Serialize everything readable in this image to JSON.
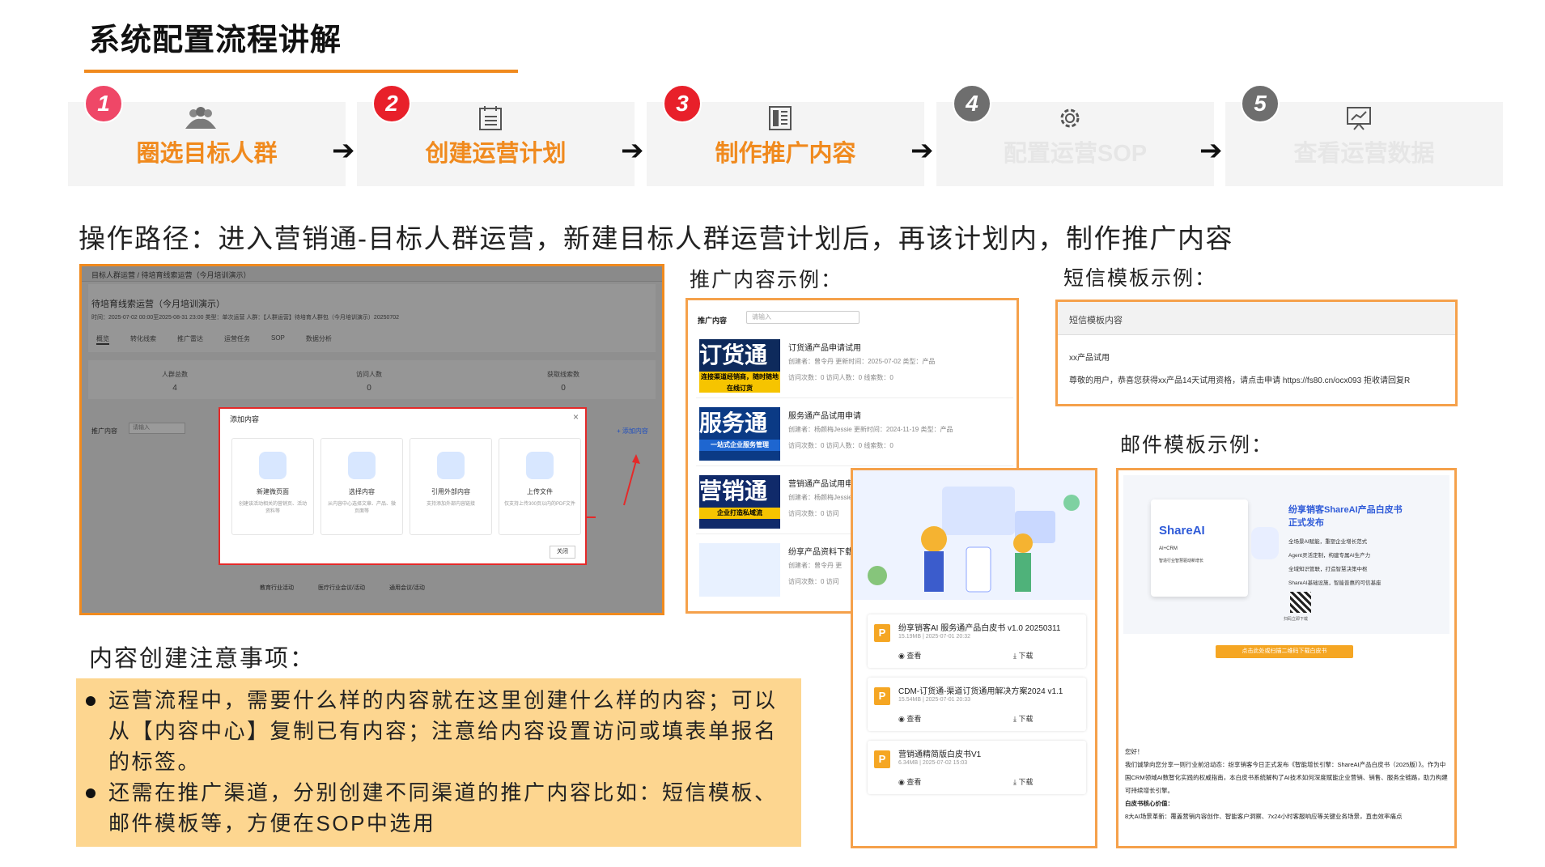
{
  "page": {
    "title": "系统配置流程讲解"
  },
  "steps": [
    {
      "num": "1",
      "label": "圈选目标人群",
      "icon": "people-icon",
      "state": "active",
      "num_color": "#EF4767"
    },
    {
      "num": "2",
      "label": "创建运营计划",
      "icon": "calendar-list-icon",
      "state": "active",
      "num_color": "#E8202A"
    },
    {
      "num": "3",
      "label": "制作推广内容",
      "icon": "content-layout-icon",
      "state": "active",
      "num_color": "#E8202A"
    },
    {
      "num": "4",
      "label": "配置运营SOP",
      "icon": "gear-icon",
      "state": "inactive",
      "num_color": "#6E6E6E"
    },
    {
      "num": "5",
      "label": "查看运营数据",
      "icon": "presentation-chart-icon",
      "state": "inactive",
      "num_color": "#6E6E6E"
    }
  ],
  "operation_path": "操作路径：进入营销通-目标人群运营，新建目标人群运营计划后，再该计划内，制作推广内容",
  "captions": {
    "promo": "推广内容示例：",
    "sms": "短信模板示例：",
    "email": "邮件模板示例："
  },
  "left_shot": {
    "breadcrumb": "目标人群运营 / 待培育线索运营（今月培训演示）",
    "plan_title": "待培育线索运营（今月培训演示）",
    "plan_meta": "时间：2025-07-02 00:00至2025-08-31 23:00    类型：单次运营    人群：【人群运营】待培育人群包（今月培训演示）20250702",
    "tabs": [
      "概览",
      "转化线索",
      "推广雷达",
      "运营任务",
      "SOP",
      "数据分析"
    ],
    "stats": [
      {
        "label": "人群总数",
        "value": "4"
      },
      {
        "label": "访问人数",
        "value": "0"
      },
      {
        "label": "获取线索数",
        "value": "0"
      }
    ],
    "section_label": "推广内容",
    "search_placeholder": "请输入",
    "add_link": "+ 添加内容",
    "modal": {
      "title": "添加内容",
      "close": "×",
      "cards": [
        {
          "title": "新建微页面",
          "desc": "创建该活动相关的营销页、活动资料等"
        },
        {
          "title": "选择内容",
          "desc": "从内容中心选择文章、产品、微页面等"
        },
        {
          "title": "引用外部内容",
          "desc": "支持添加外部内容链接"
        },
        {
          "title": "上传文件",
          "desc": "仅支持上传300页以内的PDF文件"
        }
      ],
      "close_button": "关闭"
    },
    "footer_labels": [
      "教育行业活动",
      "医疗行业会议/活动",
      "通用会议/活动"
    ]
  },
  "promo_shot": {
    "header_label": "推广内容",
    "search_placeholder": "请输入",
    "items": [
      {
        "thumb": "订货通",
        "thumb_sub": "连接渠道经销商，随时随地在线订货",
        "title": "订货通产品申请试用",
        "meta": "创建者：曾令丹    更新时间：2025-07-02    类型：产品",
        "stats": "访问次数：0    访问人数：0    线索数：0"
      },
      {
        "thumb": "服务通",
        "thumb_sub": "一站式企业服务管理",
        "title": "服务通产品试用申请",
        "meta": "创建者：杨颜梅Jessie    更新时间：2024-11-19    类型：产品",
        "stats": "访问次数：0    访问人数：0    线索数：0"
      },
      {
        "thumb": "营销通",
        "thumb_sub": "企业打造私域流",
        "title": "营销通产品试用申",
        "meta": "创建者：杨颜梅Jessie",
        "stats": "访问次数：0    访问"
      },
      {
        "thumb": "",
        "thumb_sub": "",
        "title": "纷享产品资料下载",
        "meta": "创建者：曾令丹    更",
        "stats": "访问次数：0    访问"
      }
    ]
  },
  "sms_shot": {
    "header": "短信模板内容",
    "line1": "xx产品试用",
    "line2": "尊敬的用户，恭喜您获得xx产品14天试用资格，请点击申请 https://fs80.cn/ocx093 拒收请回复R"
  },
  "doc_shot": {
    "docs": [
      {
        "title": "纷享销客AI 服务通产品白皮书 v1.0 20250311",
        "meta": "15.19MB  |  2025-07-01 20:32",
        "view": "查看",
        "download": "下载"
      },
      {
        "title": "CDM-订货通-渠道订货通用解决方案2024 v1.1",
        "meta": "15.54MB  |  2025-07-01 20:33",
        "view": "查看",
        "download": "下载"
      },
      {
        "title": "营销通精简版白皮书V1",
        "meta": "6.34MB  |  2025-07-02 15:03",
        "view": "查看",
        "download": "下载"
      }
    ]
  },
  "mail_shot": {
    "brand": "ShareAI",
    "brand_sub": "AI+CRM",
    "brand_tag": "智造行业智慧驱动新增长",
    "headline1": "纷享销客ShareAI产品白皮书",
    "headline2": "正式发布",
    "bullets": [
      "全场景AI赋能，重塑企业增长范式",
      "Agent灵活定制，构建专属AI生产力",
      "全域知识管联，打造智慧决策中枢",
      "ShareAI基础设施，智能普惠的可信基座"
    ],
    "qr_caption": "扫码立即下载",
    "cta": "点击此处或扫描二维码下载白皮书",
    "greeting": "您好！",
    "body1": "我们诚挚向您分享一则行业前沿动态：纷享销客今日正式发布《智能增长引擎：ShareAI产品白皮书（2025版）》。作为中国CRM领域AI数智化实践的权威指南，本白皮书系统解构了AI技术如何深度赋能企业营销、销售、服务全链路，助力构建可持续增长引擎。",
    "body2": "白皮书核心价值：",
    "body3": "8大AI场景革新：覆盖营销内容创作、智能客户洞察、7x24小时客服响应等关键业务场景，直击效率痛点"
  },
  "notes": {
    "title": "内容创建注意事项：",
    "item1_lines": [
      "运营流程中，需要什么样的内容就在这里创建什么样的内容；可以",
      "从【内容中心】复制已有内容；注意给内容设置访问或填表单报名",
      "的标签。"
    ],
    "item2_lines": [
      "还需在推广渠道，分别创建不同渠道的推广内容比如：短信模板、",
      "邮件模板等，方便在SOP中选用"
    ]
  },
  "colors": {
    "accent": "#F08A1E",
    "num_red": "#E8202A",
    "num_gray": "#6E6E6E",
    "note_bg": "#FDD690",
    "inactive_text": "#E6E6E6"
  }
}
